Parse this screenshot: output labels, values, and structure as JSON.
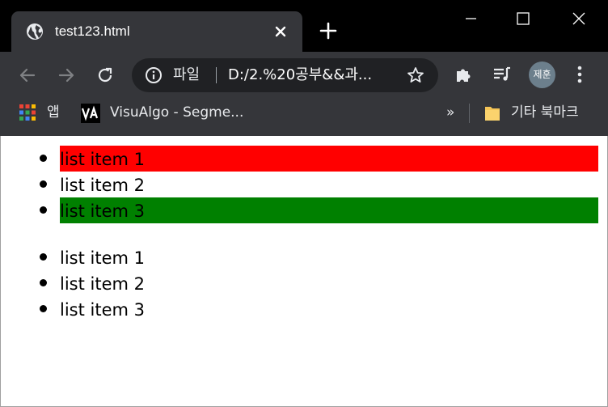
{
  "browser": {
    "tab": {
      "title": "test123.html",
      "favicon": "globe-icon"
    },
    "toolbar": {
      "scheme_label": "파일",
      "url": "D:/2.%20공부&&과...",
      "profile_initials": "제훈"
    },
    "bookmarks": {
      "apps_label": "앱",
      "items": [
        {
          "label": "VisuAlgo - Segme..."
        }
      ],
      "overflow_label": "»",
      "other_bookmarks_label": "기타 북마크"
    }
  },
  "page": {
    "list_1": [
      {
        "text": "list item 1",
        "background": "#ff0000"
      },
      {
        "text": "list item 2",
        "background": ""
      },
      {
        "text": "list item 3",
        "background": "#008000"
      }
    ],
    "list_2": [
      {
        "text": "list item 1"
      },
      {
        "text": "list item 2"
      },
      {
        "text": "list item 3"
      }
    ]
  },
  "colors": {
    "titlebar": "#000000",
    "toolbar": "#35363a",
    "omnibox": "#202124",
    "highlight_red": "#ff0000",
    "highlight_green": "#008000"
  }
}
